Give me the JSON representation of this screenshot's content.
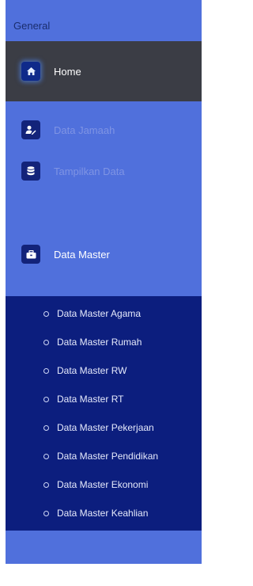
{
  "sidebar": {
    "section_label": "General",
    "menu": [
      {
        "label": "Home",
        "icon": "home-icon",
        "active": true
      },
      {
        "label": "Data Jamaah",
        "icon": "user-edit-icon",
        "active": false
      },
      {
        "label": "Tampilkan Data",
        "icon": "database-icon",
        "active": false
      },
      {
        "label": "Data Master",
        "icon": "toolbox-icon",
        "active": false
      }
    ],
    "submenu": [
      "Data Master Agama",
      "Data Master Rumah",
      "Data Master RW",
      "Data Master RT",
      "Data Master Pekerjaan",
      "Data Master Pendidikan",
      "Data Master Ekonomi",
      "Data Master Keahlian"
    ]
  },
  "colors": {
    "sidebar_bg": "#5070dc",
    "active_item_bg": "#3b3d45",
    "submenu_bg": "#0c1e7e",
    "icon_bg": "#13237a"
  }
}
